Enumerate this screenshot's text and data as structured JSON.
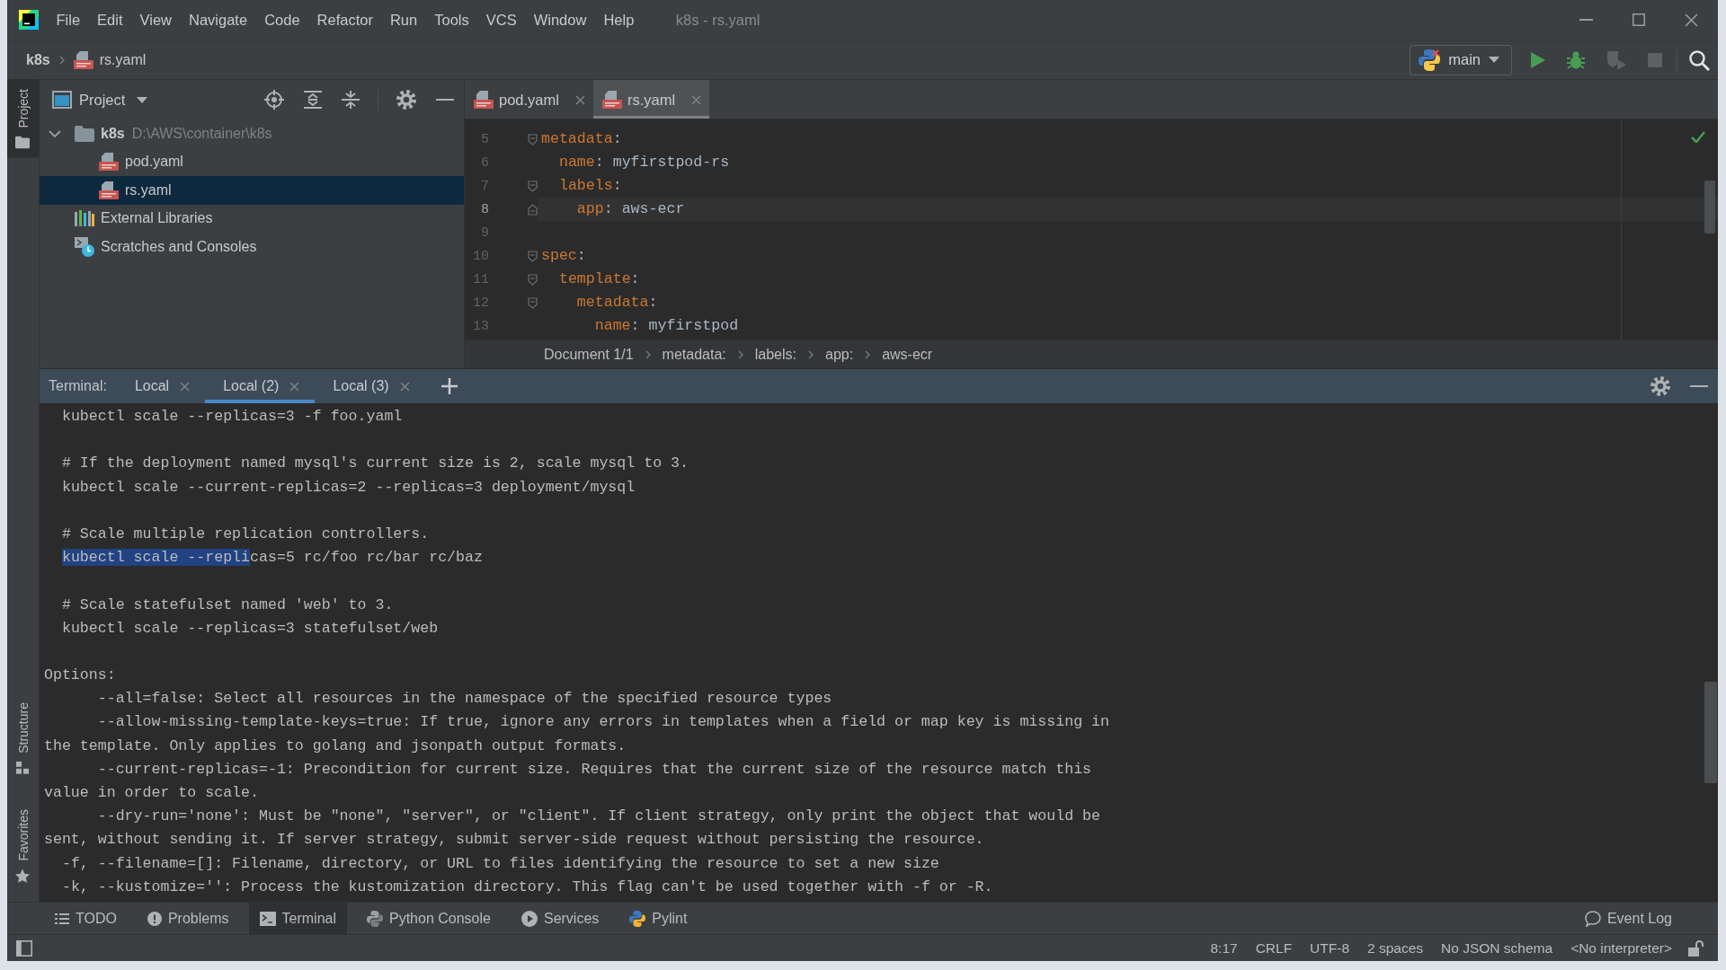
{
  "menu_bar": {
    "items": [
      "File",
      "Edit",
      "View",
      "Navigate",
      "Code",
      "Refactor",
      "Run",
      "Tools",
      "VCS",
      "Window",
      "Help"
    ],
    "window_title": "k8s - rs.yaml"
  },
  "navigation_bar": {
    "breadcrumbs": [
      {
        "label": "k8s",
        "kind": "project"
      },
      {
        "label": "rs.yaml",
        "kind": "yaml"
      }
    ],
    "run_configuration": "main"
  },
  "tool_stripe": {
    "top": [
      {
        "label": "Project",
        "kind": "project",
        "selected": true
      }
    ],
    "bottom": [
      {
        "label": "Structure",
        "kind": "structure",
        "selected": false
      },
      {
        "label": "Favorites",
        "kind": "favorites",
        "selected": false
      }
    ]
  },
  "project_panel": {
    "title": "Project",
    "tree": [
      {
        "label": "k8s",
        "path": "D:\\AWS\\container\\k8s",
        "kind": "folder",
        "expanded": true,
        "selected": false,
        "children": [
          {
            "label": "pod.yaml",
            "kind": "yaml",
            "selected": false
          },
          {
            "label": "rs.yaml",
            "kind": "yaml",
            "selected": true
          }
        ]
      },
      {
        "label": "External Libraries",
        "kind": "libraries",
        "selected": false
      },
      {
        "label": "Scratches and Consoles",
        "kind": "scratches",
        "selected": false
      }
    ]
  },
  "editor": {
    "tabs": [
      {
        "label": "pod.yaml",
        "kind": "yaml",
        "selected": false
      },
      {
        "label": "rs.yaml",
        "kind": "yaml",
        "selected": true
      }
    ],
    "lines": [
      {
        "number": "5",
        "code": "metadata:",
        "fold_start": true,
        "fold_end": false,
        "current": false
      },
      {
        "number": "6",
        "code": "  name: myfirstpod-rs",
        "fold_start": false,
        "fold_end": false,
        "current": false
      },
      {
        "number": "7",
        "code": "  labels:",
        "fold_start": true,
        "fold_end": false,
        "current": false
      },
      {
        "number": "8",
        "code": "    app: aws-ecr",
        "fold_start": false,
        "fold_end": true,
        "current": true
      },
      {
        "number": "9",
        "fold_start": false,
        "fold_end": false,
        "current": false
      },
      {
        "number": "10",
        "code": "spec:",
        "fold_start": true,
        "fold_end": false,
        "current": false
      },
      {
        "number": "11",
        "code": "  template:",
        "fold_start": true,
        "fold_end": false,
        "current": false
      },
      {
        "number": "12",
        "code": "    metadata:",
        "fold_start": true,
        "fold_end": false,
        "current": false
      },
      {
        "number": "13",
        "code": "      name: myfirstpod",
        "fold_start": false,
        "fold_end": false,
        "current": false
      }
    ],
    "breadcrumbs": [
      "Document 1/1",
      "metadata:",
      "labels:",
      "app:",
      "aws-ecr"
    ]
  },
  "terminal": {
    "title": "Terminal:",
    "tabs": [
      {
        "label": "Local",
        "selected": false
      },
      {
        "label": "Local (2)",
        "selected": true
      },
      {
        "label": "Local (3)",
        "selected": false
      }
    ],
    "blocks": [
      {
        "lines": [
          {
            "text": "  kubectl scale --replicas=3 -f foo.yaml"
          }
        ]
      },
      {
        "lines": [
          {
            "text": "  # If the deployment named mysql's current size is 2, scale mysql to 3."
          },
          {
            "text": "  kubectl scale --current-replicas=2 --replicas=3 deployment/mysql"
          }
        ]
      },
      {
        "lines": [
          {
            "text": "  # Scale multiple replication controllers."
          },
          {
            "segments": [
              {
                "text": "  kubectl scale --repli",
                "selected": true
              },
              {
                "text": "cas=5 rc/foo rc/bar rc/baz",
                "selected": false
              }
            ]
          }
        ]
      },
      {
        "lines": [
          {
            "text": "  # Scale statefulset named 'web' to 3."
          },
          {
            "text": "  kubectl scale --replicas=3 statefulset/web"
          }
        ]
      },
      {
        "lines": [
          {
            "text": "Options:"
          },
          {
            "text": "      --all=false: Select all resources in the namespace of the specified resource types"
          },
          {
            "text": "      --allow-missing-template-keys=true: If true, ignore any errors in templates when a field or map key is missing in"
          },
          {
            "text": "the template. Only applies to golang and jsonpath output formats."
          },
          {
            "text": "      --current-replicas=-1: Precondition for current size. Requires that the current size of the resource match this"
          },
          {
            "text": "value in order to scale."
          },
          {
            "text": "      --dry-run='none': Must be \"none\", \"server\", or \"client\". If client strategy, only print the object that would be"
          },
          {
            "text": "sent, without sending it. If server strategy, submit server-side request without persisting the resource."
          },
          {
            "text": "  -f, --filename=[]: Filename, directory, or URL to files identifying the resource to set a new size"
          },
          {
            "text": "  -k, --kustomize='': Process the kustomization directory. This flag can't be used together with -f or -R."
          }
        ]
      }
    ]
  },
  "tool_window_bar": {
    "items": [
      {
        "label": "TODO",
        "kind": "todo",
        "selected": false
      },
      {
        "label": "Problems",
        "kind": "problems",
        "selected": false
      },
      {
        "label": "Terminal",
        "kind": "terminal",
        "selected": true
      },
      {
        "label": "Python Console",
        "kind": "python_console",
        "selected": false
      },
      {
        "label": "Services",
        "kind": "services",
        "selected": false
      },
      {
        "label": "Pylint",
        "kind": "pylint",
        "selected": false
      }
    ],
    "event_log": "Event Log"
  },
  "status_bar": {
    "items": [
      "8:17",
      "CRLF",
      "UTF-8",
      "2 spaces",
      "No JSON schema",
      "<No interpreter>"
    ]
  }
}
